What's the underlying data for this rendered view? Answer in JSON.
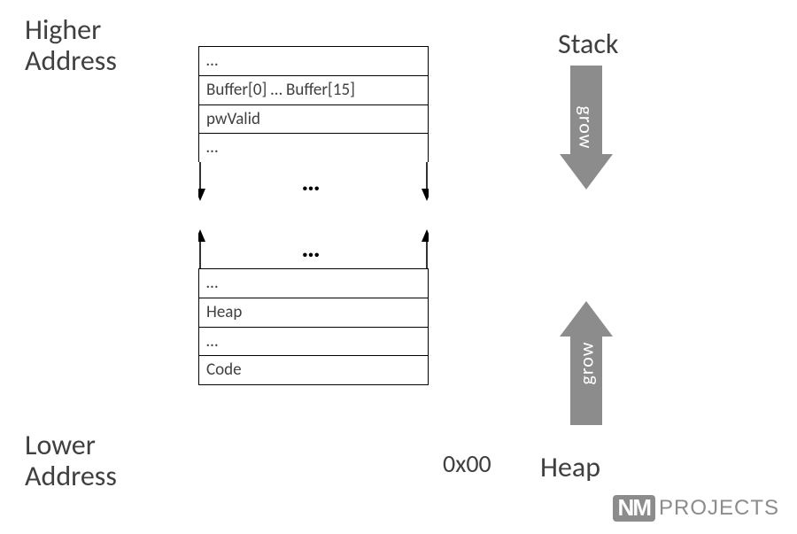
{
  "labels": {
    "higher_line1": "Higher",
    "higher_line2": "Address",
    "lower_line1": "Lower",
    "lower_line2": "Address",
    "stack": "Stack",
    "heap": "Heap",
    "grow": "grow",
    "addr_zero": "0x00"
  },
  "memory": {
    "upper": [
      "…",
      "Buffer[0] … Buffer[15]",
      "pwValid",
      "…"
    ],
    "lower": [
      "…",
      "Heap",
      "…",
      "Code"
    ],
    "gap_dots": "…"
  },
  "logo": {
    "nm": "NM",
    "projects": "PROJECTS"
  },
  "colors": {
    "arrow_fill": "#8c8c8c",
    "text": "#404040"
  }
}
